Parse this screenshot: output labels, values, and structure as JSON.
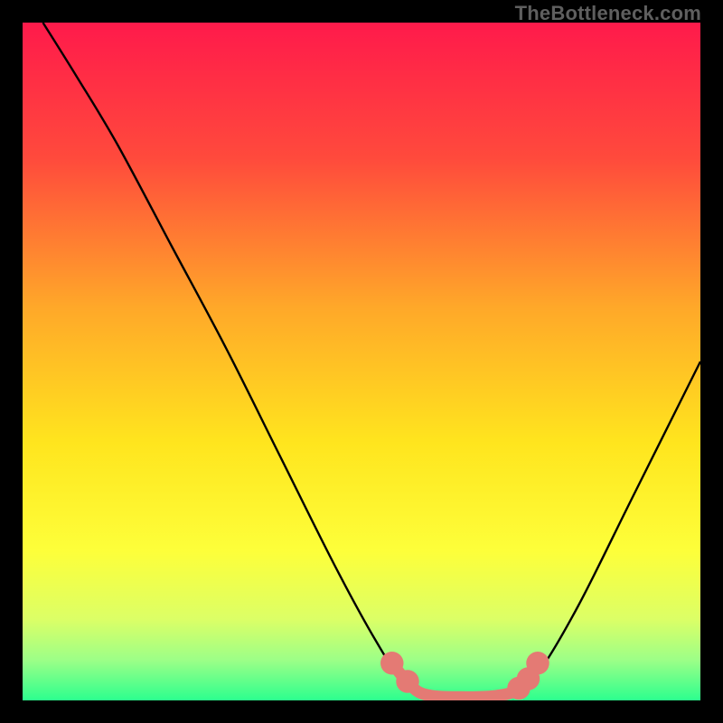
{
  "watermark": "TheBottleneck.com",
  "chart_data": {
    "type": "line",
    "title": "",
    "xlabel": "",
    "ylabel": "",
    "xlim": [
      0,
      100
    ],
    "ylim": [
      0,
      100
    ],
    "background_gradient_stops": [
      {
        "offset": 0.0,
        "color": "#ff1a4b"
      },
      {
        "offset": 0.2,
        "color": "#ff4a3c"
      },
      {
        "offset": 0.42,
        "color": "#ffa829"
      },
      {
        "offset": 0.62,
        "color": "#ffe51e"
      },
      {
        "offset": 0.78,
        "color": "#fdff3a"
      },
      {
        "offset": 0.88,
        "color": "#dcff66"
      },
      {
        "offset": 0.94,
        "color": "#9dff87"
      },
      {
        "offset": 1.0,
        "color": "#2cff8e"
      }
    ],
    "series": [
      {
        "name": "bottleneck-curve",
        "type": "line",
        "color": "#000000",
        "points": [
          {
            "x": 3.0,
            "y": 100.0
          },
          {
            "x": 8.0,
            "y": 92.0
          },
          {
            "x": 14.0,
            "y": 82.0
          },
          {
            "x": 22.0,
            "y": 67.0
          },
          {
            "x": 30.0,
            "y": 52.0
          },
          {
            "x": 38.0,
            "y": 36.0
          },
          {
            "x": 46.0,
            "y": 20.0
          },
          {
            "x": 52.0,
            "y": 9.0
          },
          {
            "x": 56.0,
            "y": 3.0
          },
          {
            "x": 60.0,
            "y": 0.6
          },
          {
            "x": 66.0,
            "y": 0.4
          },
          {
            "x": 72.0,
            "y": 1.0
          },
          {
            "x": 76.0,
            "y": 4.0
          },
          {
            "x": 82.0,
            "y": 14.0
          },
          {
            "x": 90.0,
            "y": 30.0
          },
          {
            "x": 100.0,
            "y": 50.0
          }
        ]
      },
      {
        "name": "optimal-band",
        "type": "line",
        "color": "#e47a74",
        "points": [
          {
            "x": 54.5,
            "y": 5.5
          },
          {
            "x": 56.5,
            "y": 3.0
          },
          {
            "x": 58.5,
            "y": 1.2
          },
          {
            "x": 61.0,
            "y": 0.6
          },
          {
            "x": 64.0,
            "y": 0.5
          },
          {
            "x": 67.0,
            "y": 0.5
          },
          {
            "x": 70.0,
            "y": 0.7
          },
          {
            "x": 72.5,
            "y": 1.3
          },
          {
            "x": 74.5,
            "y": 3.0
          },
          {
            "x": 76.0,
            "y": 5.5
          }
        ]
      }
    ],
    "markers": [
      {
        "x": 54.5,
        "y": 5.5,
        "r": 1.3,
        "color": "#e47a74"
      },
      {
        "x": 56.8,
        "y": 2.8,
        "r": 1.3,
        "color": "#e47a74"
      },
      {
        "x": 73.2,
        "y": 1.8,
        "r": 1.3,
        "color": "#e47a74"
      },
      {
        "x": 74.6,
        "y": 3.2,
        "r": 1.3,
        "color": "#e47a74"
      },
      {
        "x": 76.0,
        "y": 5.5,
        "r": 1.3,
        "color": "#e47a74"
      }
    ]
  }
}
